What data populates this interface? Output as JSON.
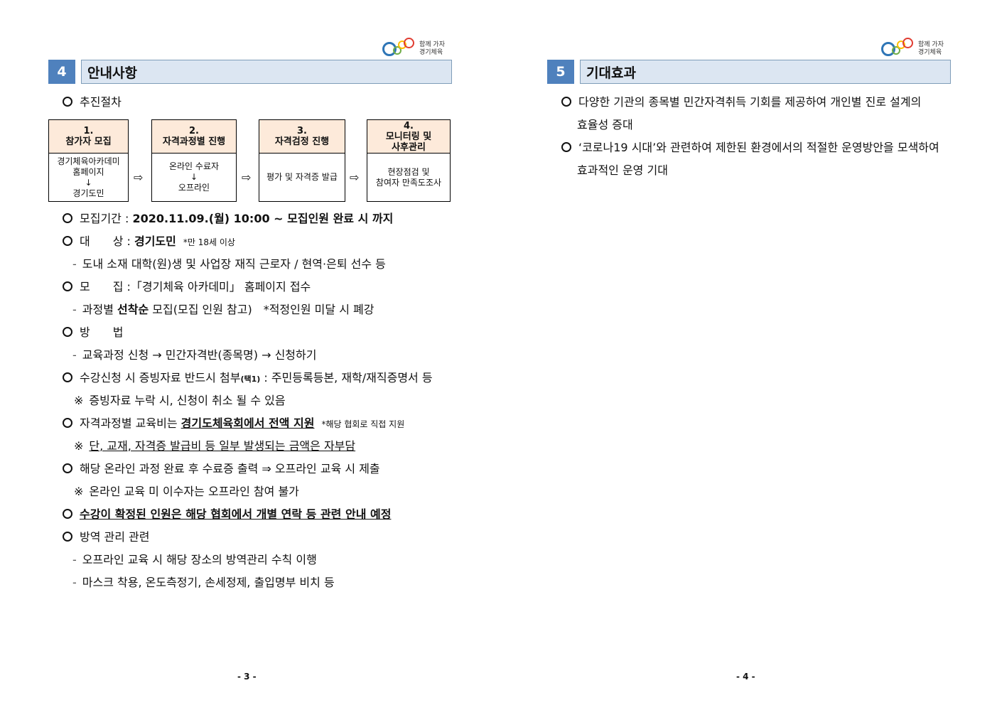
{
  "logo": {
    "line1": "함께 가자",
    "line2": "경기체육"
  },
  "left_page": {
    "section_number": "4",
    "section_title": "안내사항",
    "procedure_label": "추진절차",
    "flow_steps": [
      {
        "num": "1.",
        "title": "참가자 모집",
        "body": [
          "경기체육아카데미",
          "홈페이지",
          "↓",
          "경기도민"
        ]
      },
      {
        "num": "2.",
        "title": "자격과정별 진행",
        "body": [
          "온라인 수료자",
          "↓",
          "오프라인"
        ]
      },
      {
        "num": "3.",
        "title": "자격검정 진행",
        "body": [
          "평가 및 자격증 발급"
        ]
      },
      {
        "num": "4.",
        "title": "모니터링 및",
        "title2": "사후관리",
        "body": [
          "현장점검 및",
          "참여자 만족도조사"
        ]
      }
    ],
    "arrow": "⇨",
    "period_label": "모집기간 :",
    "period_value": "2020.11.09.(월) 10:00 ~ 모집인원 완료 시 까지",
    "target_label": "대　　상 :",
    "target_value": "경기도민",
    "target_note": "*만 18세 이상",
    "target_sub": "도내 소재 대학(원)생 및 사업장 재직 근로자 / 현역·은퇴 선수 등",
    "recruit_label": "모　　집 :",
    "recruit_value": "「경기체육 아카데미」 홈페이지 접수",
    "recruit_sub_a": "과정별 ",
    "recruit_sub_b": "선착순",
    "recruit_sub_c": " 모집(모집 인원 참고)　*적정인원 미달 시 폐강",
    "method_label": "방　　법",
    "method_sub": "교육과정 신청 → 민간자격반(종목명) → 신청하기",
    "docs_a": "수강신청 시 증빙자료 반드시 첨부",
    "docs_b": "(택1)",
    "docs_c": " : 주민등록등본, 재학/재직증명서 등",
    "docs_note": "증빙자료 누락 시, 신청이 취소 될 수 있음",
    "fee_a": "자격과정별 교육비는 ",
    "fee_b": "경기도체육회에서 전액 지원",
    "fee_note": "*해당 협회로 직접 지원",
    "fee_sub": "단, 교재, 자격증 발급비 등 일부 발생되는 금액은 자부담",
    "online_line": "해당 온라인 과정 완료 후 수료증 출력 ⇒ 오프라인 교육 시 제출",
    "online_note": "온라인 교육 미 이수자는 오프라인 참여 불가",
    "confirm_line": "수강이 확정된 인원은 해당 협회에서 개별 연락 등 관련 안내 예정",
    "quarantine_label": "방역 관리 관련",
    "quarantine_sub1": "오프라인 교육 시 해당 장소의 방역관리 수칙 이행",
    "quarantine_sub2": "마스크 착용, 온도측정기, 손세정제, 출입명부 비치 등",
    "ref_mark": "※",
    "dash_mark": "-",
    "page_number": "- 3 -"
  },
  "right_page": {
    "section_number": "5",
    "section_title": "기대효과",
    "effect1_line1": "다양한 기관의 종목별 민간자격취득 기회를 제공하여 개인별 진로 설계의",
    "effect1_line2": "효율성 증대",
    "effect2_line1": "‘코로나19 시대’와 관련하여 제한된 환경에서의 적절한 운영방안을 모색하여",
    "effect2_line2": "효과적인 운영 기대",
    "page_number": "- 4 -"
  },
  "colors": {
    "section_blue": "#4f81bd",
    "title_bg": "#dce6f2",
    "flow_head_bg": "#fdeada"
  }
}
